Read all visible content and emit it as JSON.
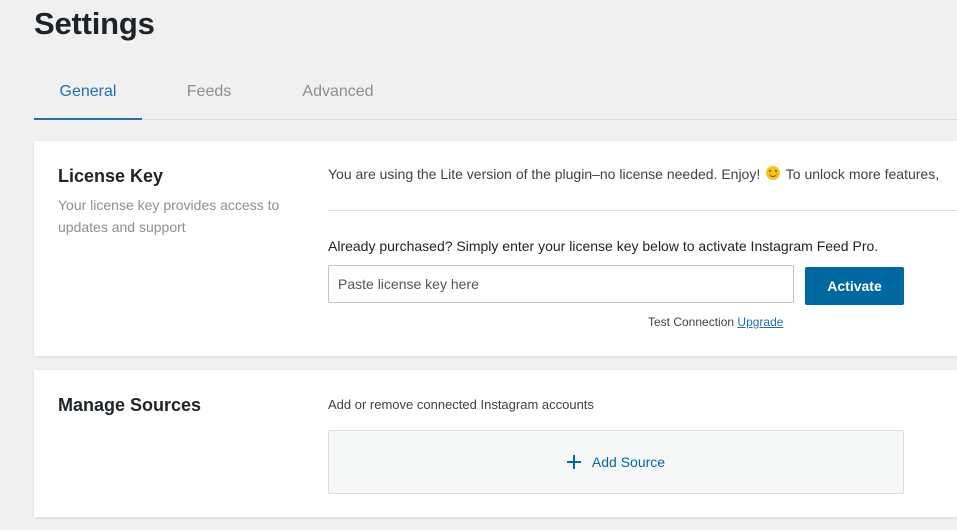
{
  "page": {
    "title": "Settings"
  },
  "tabs": [
    {
      "label": "General",
      "active": true
    },
    {
      "label": "Feeds",
      "active": false
    },
    {
      "label": "Advanced",
      "active": false
    }
  ],
  "license": {
    "title": "License Key",
    "description": "Your license key provides access to updates and support",
    "notice_before": "You are using the Lite version of the plugin–no license needed. Enjoy!",
    "emoji_icon": "smiley-face-icon",
    "notice_after": "To unlock more features,",
    "purchased_text": "Already purchased? Simply enter your license key below to activate Instagram Feed Pro.",
    "input_value": "",
    "input_placeholder": "Paste license key here",
    "activate_label": "Activate",
    "test_connection_label": "Test Connection",
    "upgrade_label": "Upgrade"
  },
  "sources": {
    "title": "Manage Sources",
    "description": "Add or remove connected Instagram accounts",
    "add_icon": "plus-icon",
    "add_label": "Add Source"
  },
  "colors": {
    "accent": "#2271b1",
    "button": "#0068a0",
    "background": "#f0f0f1"
  }
}
